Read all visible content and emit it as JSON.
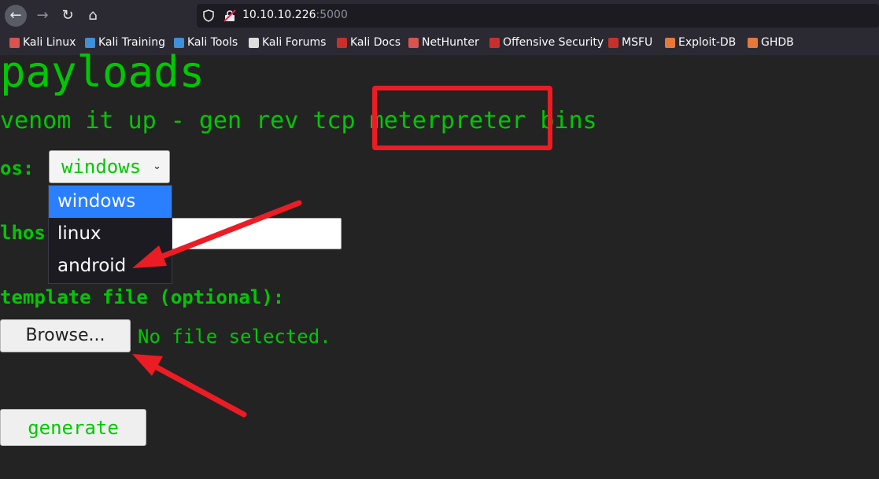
{
  "browser": {
    "url_host": "10.10.10.226",
    "url_port": ":5000",
    "bookmarks": [
      {
        "label": "Kali Linux",
        "color": "#d9534f"
      },
      {
        "label": "Kali Training",
        "color": "#3f8fd9"
      },
      {
        "label": "Kali Tools",
        "color": "#3f8fd9"
      },
      {
        "label": "Kali Forums",
        "color": "#dddddd"
      },
      {
        "label": "Kali Docs",
        "color": "#c9302c"
      },
      {
        "label": "NetHunter",
        "color": "#d9534f"
      },
      {
        "label": "Offensive Security",
        "color": "#c9302c"
      },
      {
        "label": "MSFU",
        "color": "#c9302c"
      },
      {
        "label": "Exploit-DB",
        "color": "#e6783a"
      },
      {
        "label": "GHDB",
        "color": "#e6783a"
      }
    ]
  },
  "page": {
    "title": "payloads",
    "subtitle": "venom it up - gen rev tcp meterpreter bins",
    "os_label": "os:",
    "os_selected": "windows",
    "os_options": [
      "windows",
      "linux",
      "android"
    ],
    "lhost_label_visible": "lhos",
    "lhost_value": "",
    "template_label": "template file (optional):",
    "browse_label": "Browse...",
    "file_status": "No file selected.",
    "generate_label": "generate"
  },
  "colors": {
    "accent_green": "#00c800",
    "annotation_red": "#ec1c24",
    "selected_option": "#2a7fff"
  }
}
